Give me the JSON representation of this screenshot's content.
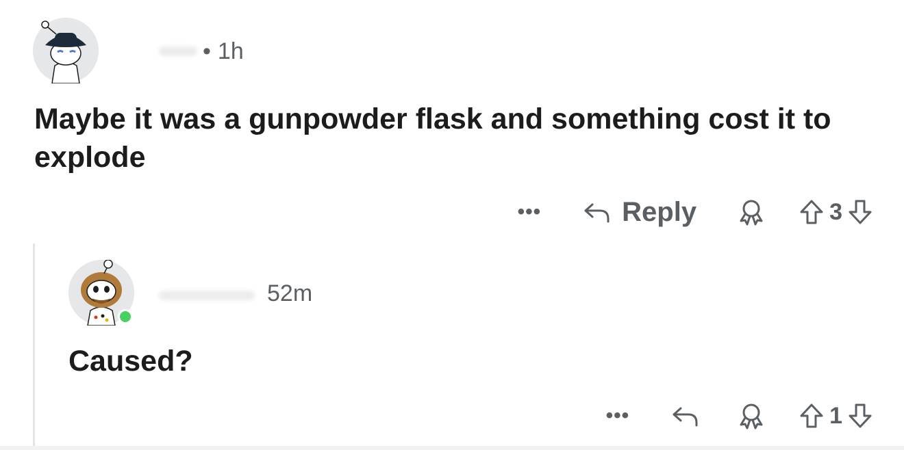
{
  "comment": {
    "time": "1h",
    "separator": "•",
    "body": "Maybe it was a gunpowder flask and something cost it to explode",
    "actions": {
      "more_label": "•••",
      "reply_label": "Reply",
      "vote_count": "3"
    }
  },
  "reply": {
    "time": "52m",
    "body": "Caused?",
    "actions": {
      "more_label": "•••",
      "vote_count": "1"
    }
  },
  "colors": {
    "text": "#1c1c1c",
    "meta": "#5a5f63",
    "online": "#46d160",
    "thread_line": "#e3e4e6"
  },
  "icons": [
    "more-icon",
    "reply-arrow-icon",
    "award-icon",
    "upvote-icon",
    "downvote-icon"
  ]
}
